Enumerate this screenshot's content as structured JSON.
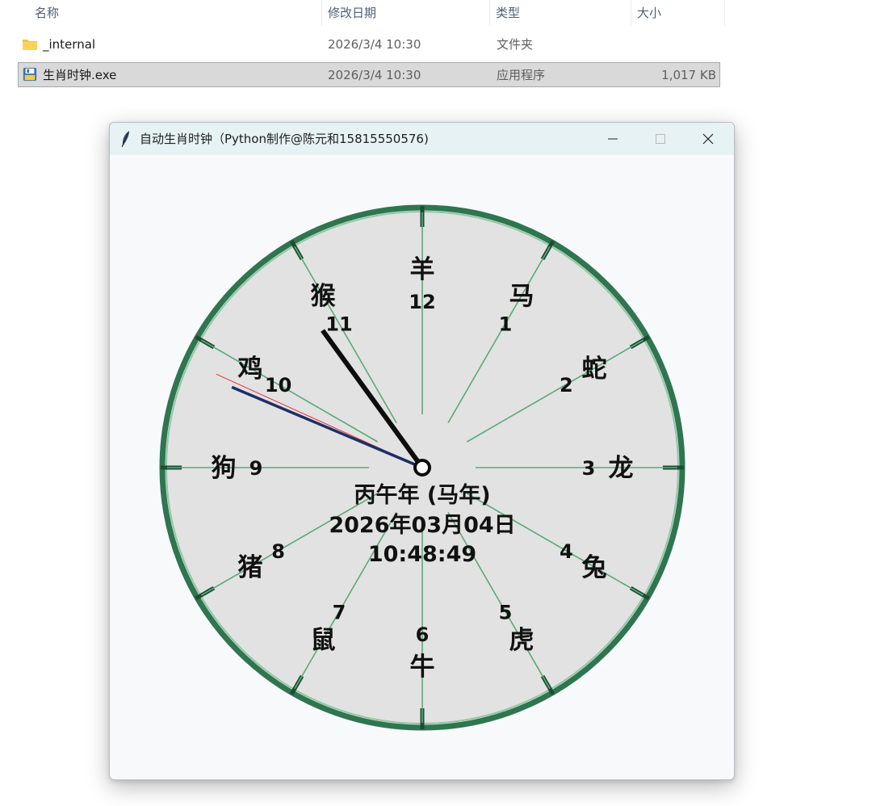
{
  "explorer": {
    "columns": {
      "name": "名称",
      "date": "修改日期",
      "type": "类型",
      "size": "大小"
    },
    "files": [
      {
        "name": "_internal",
        "date": "2026/3/4 10:30",
        "type": "文件夹",
        "size": "",
        "icon": "folder-icon"
      },
      {
        "name": "生肖时钟.exe",
        "date": "2026/3/4 10:30",
        "type": "应用程序",
        "size": "1,017 KB",
        "icon": "python-exe-icon"
      }
    ]
  },
  "window": {
    "title": "自动生肖时钟（Python制作@陈元和15815550576)",
    "icon": "feather-icon",
    "controls": {
      "minimize": "minimize-icon",
      "maximize": "maximize-icon",
      "close": "close-icon"
    }
  },
  "clock": {
    "hours": [
      {
        "num": "12",
        "zodiac": "羊"
      },
      {
        "num": "1",
        "zodiac": "马"
      },
      {
        "num": "2",
        "zodiac": "蛇"
      },
      {
        "num": "3",
        "zodiac": "龙"
      },
      {
        "num": "4",
        "zodiac": "兔"
      },
      {
        "num": "5",
        "zodiac": "虎"
      },
      {
        "num": "6",
        "zodiac": "牛"
      },
      {
        "num": "7",
        "zodiac": "鼠"
      },
      {
        "num": "8",
        "zodiac": "猪"
      },
      {
        "num": "9",
        "zodiac": "狗"
      },
      {
        "num": "10",
        "zodiac": "鸡"
      },
      {
        "num": "11",
        "zodiac": "猴"
      }
    ],
    "year_line": "丙午年 (马年)",
    "date_line": "2026年03月04日",
    "time_line": "10:48:49",
    "time": {
      "hour": 10,
      "minute": 48,
      "second": 49
    },
    "colors": {
      "face": "#e2e2e2",
      "rim": "#2e7550",
      "rim_light": "#8fc9a3",
      "tick": "#1e4d34",
      "spoke": "#5aa97a",
      "hour_hand": "#0d0d0d",
      "minute_hand": "#1e2f66",
      "second_hand": "#e0323c",
      "text": "#111111"
    }
  }
}
